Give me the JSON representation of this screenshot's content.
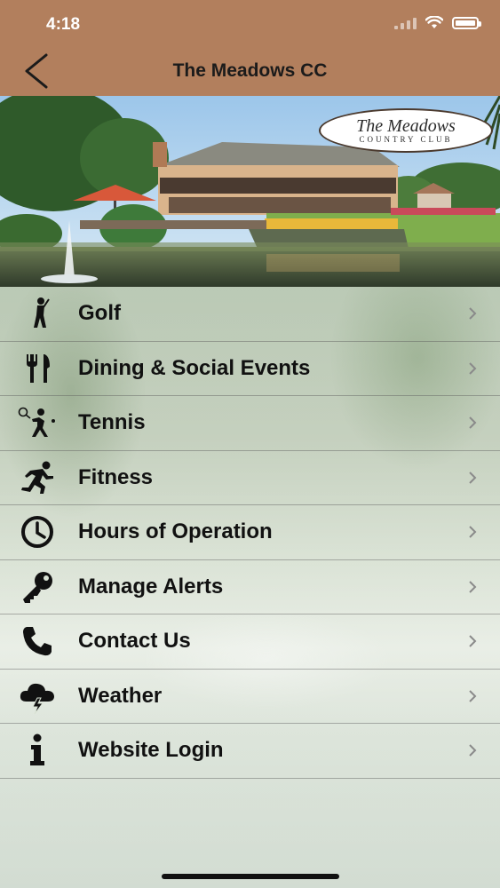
{
  "status_bar": {
    "time": "4:18"
  },
  "nav": {
    "title": "The Meadows CC",
    "back_icon": "chevron-left-icon"
  },
  "hero": {
    "logo_line1": "The Meadows",
    "logo_line2": "COUNTRY CLUB"
  },
  "menu": {
    "items": [
      {
        "label": "Golf",
        "icon": "golfer-icon"
      },
      {
        "label": "Dining & Social Events",
        "icon": "fork-knife-icon"
      },
      {
        "label": "Tennis",
        "icon": "tennis-player-icon"
      },
      {
        "label": "Fitness",
        "icon": "runner-icon"
      },
      {
        "label": "Hours of Operation",
        "icon": "clock-icon"
      },
      {
        "label": "Manage Alerts",
        "icon": "key-icon"
      },
      {
        "label": "Contact Us",
        "icon": "phone-icon"
      },
      {
        "label": "Weather",
        "icon": "storm-cloud-icon"
      },
      {
        "label": "Website Login",
        "icon": "info-icon"
      }
    ]
  },
  "colors": {
    "header_bg": "#b27f5d",
    "menu_text": "#111111"
  }
}
